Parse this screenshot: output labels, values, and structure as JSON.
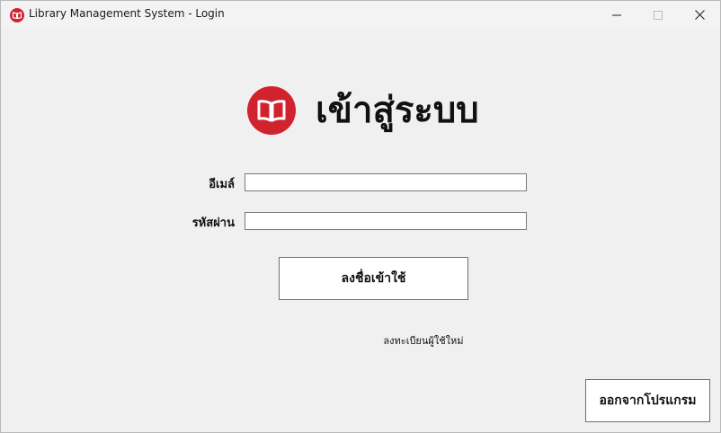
{
  "window": {
    "title": "Library Management System - Login",
    "minimize_icon": "minimize-icon",
    "maximize_icon": "maximize-icon",
    "close_icon": "close-icon",
    "app_icon": "book-icon"
  },
  "header": {
    "logo_icon": "open-book-icon",
    "title": "เข้าสู่ระบบ"
  },
  "form": {
    "email_label": "อีเมล์",
    "email_value": "",
    "password_label": "รหัสผ่าน",
    "password_value": "",
    "login_label": "ลงชื่อเข้าใช้",
    "register_label": "ลงทะเบียนผู้ใช้ใหม่"
  },
  "footer": {
    "exit_label": "ออกจากโปรแกรม"
  },
  "colors": {
    "accent": "#d0232e",
    "background": "#f0f0f0"
  }
}
